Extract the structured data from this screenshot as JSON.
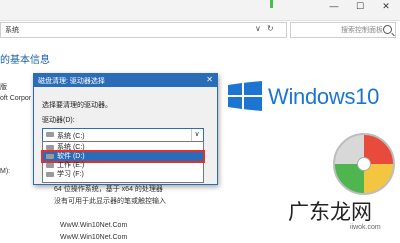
{
  "window": {
    "controls": [
      "—",
      "☐",
      "✕"
    ],
    "address_text": "系统",
    "address_chevron": "∨",
    "address_refresh": "↻",
    "search_placeholder": "搜索控制面板"
  },
  "page": {
    "title": "的基本信息",
    "label_a": "版",
    "label_b": "oft Corpor",
    "label_c": "M):",
    "info_1": "64 位操作系统，基于 x64 的处理器",
    "info_2": "没有可用于此显示器的笔或触控输入",
    "url_1": "WwW.Win10Net.Com",
    "url_2": "WwW.Win10Net.Com"
  },
  "brand": {
    "text": "Windows10",
    "color": "#1c76d1"
  },
  "dialog": {
    "title": "磁盘清理: 驱动器选择",
    "close": "✕",
    "prompt": "选择要清理的驱动器。",
    "drive_label": "驱动器(D):",
    "selected": "系统 (C:)",
    "arrow": "∨",
    "options": [
      "系统 (C:)",
      "软件 (D:)",
      "工作 (E:)",
      "学习 (F:)"
    ],
    "highlighted_index": 1
  },
  "watermark": {
    "text": "广东龙网",
    "sub": "iiwok.com"
  }
}
